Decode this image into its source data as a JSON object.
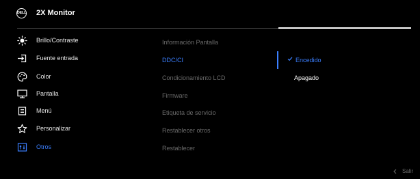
{
  "header": {
    "logo_text": "DELL",
    "title": "2X Monitor"
  },
  "menu": {
    "items": [
      {
        "label": "Brillo/Contraste",
        "icon": "brightness-icon"
      },
      {
        "label": "Fuente entrada",
        "icon": "input-source-icon"
      },
      {
        "label": "Color",
        "icon": "color-palette-icon"
      },
      {
        "label": "Pantalla",
        "icon": "display-icon"
      },
      {
        "label": "Menú",
        "icon": "menu-icon"
      },
      {
        "label": "Personalizar",
        "icon": "star-icon"
      },
      {
        "label": "Otros",
        "icon": "others-icon",
        "active": true
      }
    ]
  },
  "submenu": {
    "items": [
      {
        "label": "Información Pantalla"
      },
      {
        "label": "DDC/CI",
        "active": true
      },
      {
        "label": "Condicionamiento LCD"
      },
      {
        "label": "Firmware"
      },
      {
        "label": "Etiqueta de servicio"
      },
      {
        "label": "Restablecer otros"
      },
      {
        "label": "Restablecer"
      }
    ]
  },
  "options": {
    "items": [
      {
        "label": "Encedido",
        "selected": true
      },
      {
        "label": "Apagado"
      }
    ]
  },
  "footer": {
    "exit_label": "Salir"
  },
  "colors": {
    "background": "#000000",
    "accent": "#3b7fff",
    "inactive_text": "#6a6a6a",
    "text": "#e8e8e8"
  }
}
